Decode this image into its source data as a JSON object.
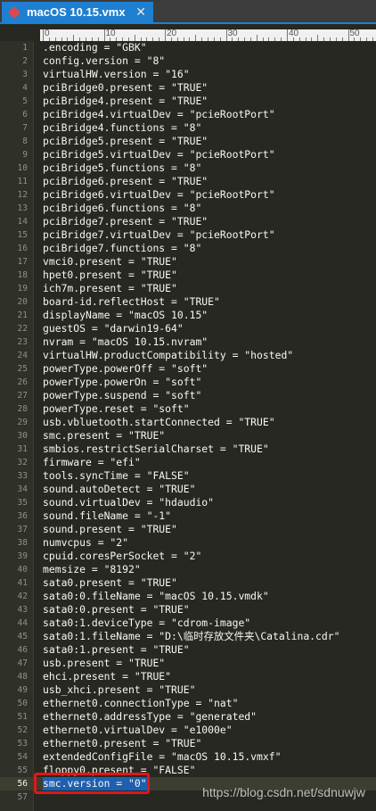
{
  "tab": {
    "title": "macOS 10.15.vmx",
    "close": "✕",
    "status_icon": "modified-diamond-icon"
  },
  "ruler": {
    "labels": [
      "0",
      "10",
      "20",
      "30",
      "40",
      "50"
    ]
  },
  "lines": [
    {
      "n": "1",
      "t": ".encoding = \"GBK\""
    },
    {
      "n": "2",
      "t": "config.version = \"8\""
    },
    {
      "n": "3",
      "t": "virtualHW.version = \"16\""
    },
    {
      "n": "4",
      "t": "pciBridge0.present = \"TRUE\""
    },
    {
      "n": "5",
      "t": "pciBridge4.present = \"TRUE\""
    },
    {
      "n": "6",
      "t": "pciBridge4.virtualDev = \"pcieRootPort\""
    },
    {
      "n": "7",
      "t": "pciBridge4.functions = \"8\""
    },
    {
      "n": "8",
      "t": "pciBridge5.present = \"TRUE\""
    },
    {
      "n": "9",
      "t": "pciBridge5.virtualDev = \"pcieRootPort\""
    },
    {
      "n": "10",
      "t": "pciBridge5.functions = \"8\""
    },
    {
      "n": "11",
      "t": "pciBridge6.present = \"TRUE\""
    },
    {
      "n": "12",
      "t": "pciBridge6.virtualDev = \"pcieRootPort\""
    },
    {
      "n": "13",
      "t": "pciBridge6.functions = \"8\""
    },
    {
      "n": "14",
      "t": "pciBridge7.present = \"TRUE\""
    },
    {
      "n": "15",
      "t": "pciBridge7.virtualDev = \"pcieRootPort\""
    },
    {
      "n": "16",
      "t": "pciBridge7.functions = \"8\""
    },
    {
      "n": "17",
      "t": "vmci0.present = \"TRUE\""
    },
    {
      "n": "18",
      "t": "hpet0.present = \"TRUE\""
    },
    {
      "n": "19",
      "t": "ich7m.present = \"TRUE\""
    },
    {
      "n": "20",
      "t": "board-id.reflectHost = \"TRUE\""
    },
    {
      "n": "21",
      "t": "displayName = \"macOS 10.15\""
    },
    {
      "n": "22",
      "t": "guestOS = \"darwin19-64\""
    },
    {
      "n": "23",
      "t": "nvram = \"macOS 10.15.nvram\""
    },
    {
      "n": "24",
      "t": "virtualHW.productCompatibility = \"hosted\""
    },
    {
      "n": "25",
      "t": "powerType.powerOff = \"soft\""
    },
    {
      "n": "26",
      "t": "powerType.powerOn = \"soft\""
    },
    {
      "n": "27",
      "t": "powerType.suspend = \"soft\""
    },
    {
      "n": "28",
      "t": "powerType.reset = \"soft\""
    },
    {
      "n": "29",
      "t": "usb.vbluetooth.startConnected = \"TRUE\""
    },
    {
      "n": "30",
      "t": "smc.present = \"TRUE\""
    },
    {
      "n": "31",
      "t": "smbios.restrictSerialCharset = \"TRUE\""
    },
    {
      "n": "32",
      "t": "firmware = \"efi\""
    },
    {
      "n": "33",
      "t": "tools.syncTime = \"FALSE\""
    },
    {
      "n": "34",
      "t": "sound.autoDetect = \"TRUE\""
    },
    {
      "n": "35",
      "t": "sound.virtualDev = \"hdaudio\""
    },
    {
      "n": "36",
      "t": "sound.fileName = \"-1\""
    },
    {
      "n": "37",
      "t": "sound.present = \"TRUE\""
    },
    {
      "n": "38",
      "t": "numvcpus = \"2\""
    },
    {
      "n": "39",
      "t": "cpuid.coresPerSocket = \"2\""
    },
    {
      "n": "40",
      "t": "memsize = \"8192\""
    },
    {
      "n": "41",
      "t": "sata0.present = \"TRUE\""
    },
    {
      "n": "42",
      "t": "sata0:0.fileName = \"macOS 10.15.vmdk\""
    },
    {
      "n": "43",
      "t": "sata0:0.present = \"TRUE\""
    },
    {
      "n": "44",
      "t": "sata0:1.deviceType = \"cdrom-image\""
    },
    {
      "n": "45",
      "t": "sata0:1.fileName = \"D:\\临时存放文件夹\\Catalina.cdr\""
    },
    {
      "n": "46",
      "t": "sata0:1.present = \"TRUE\""
    },
    {
      "n": "47",
      "t": "usb.present = \"TRUE\""
    },
    {
      "n": "48",
      "t": "ehci.present = \"TRUE\""
    },
    {
      "n": "49",
      "t": "usb_xhci.present = \"TRUE\""
    },
    {
      "n": "50",
      "t": "ethernet0.connectionType = \"nat\""
    },
    {
      "n": "51",
      "t": "ethernet0.addressType = \"generated\""
    },
    {
      "n": "52",
      "t": "ethernet0.virtualDev = \"e1000e\""
    },
    {
      "n": "53",
      "t": "ethernet0.present = \"TRUE\""
    },
    {
      "n": "54",
      "t": "extendedConfigFile = \"macOS 10.15.vmxf\""
    },
    {
      "n": "55",
      "t": "floppy0.present = \"FALSE\""
    },
    {
      "n": "56",
      "t": "smc.version = \"0\""
    },
    {
      "n": "57",
      "t": ""
    }
  ],
  "current_line": "56",
  "watermark": "https://blog.csdn.net/sdnuwjw",
  "colors": {
    "background": "#272822",
    "tab_active": "#1f7fd0",
    "text": "#f8f8f2",
    "highlight_border": "#e01818"
  }
}
